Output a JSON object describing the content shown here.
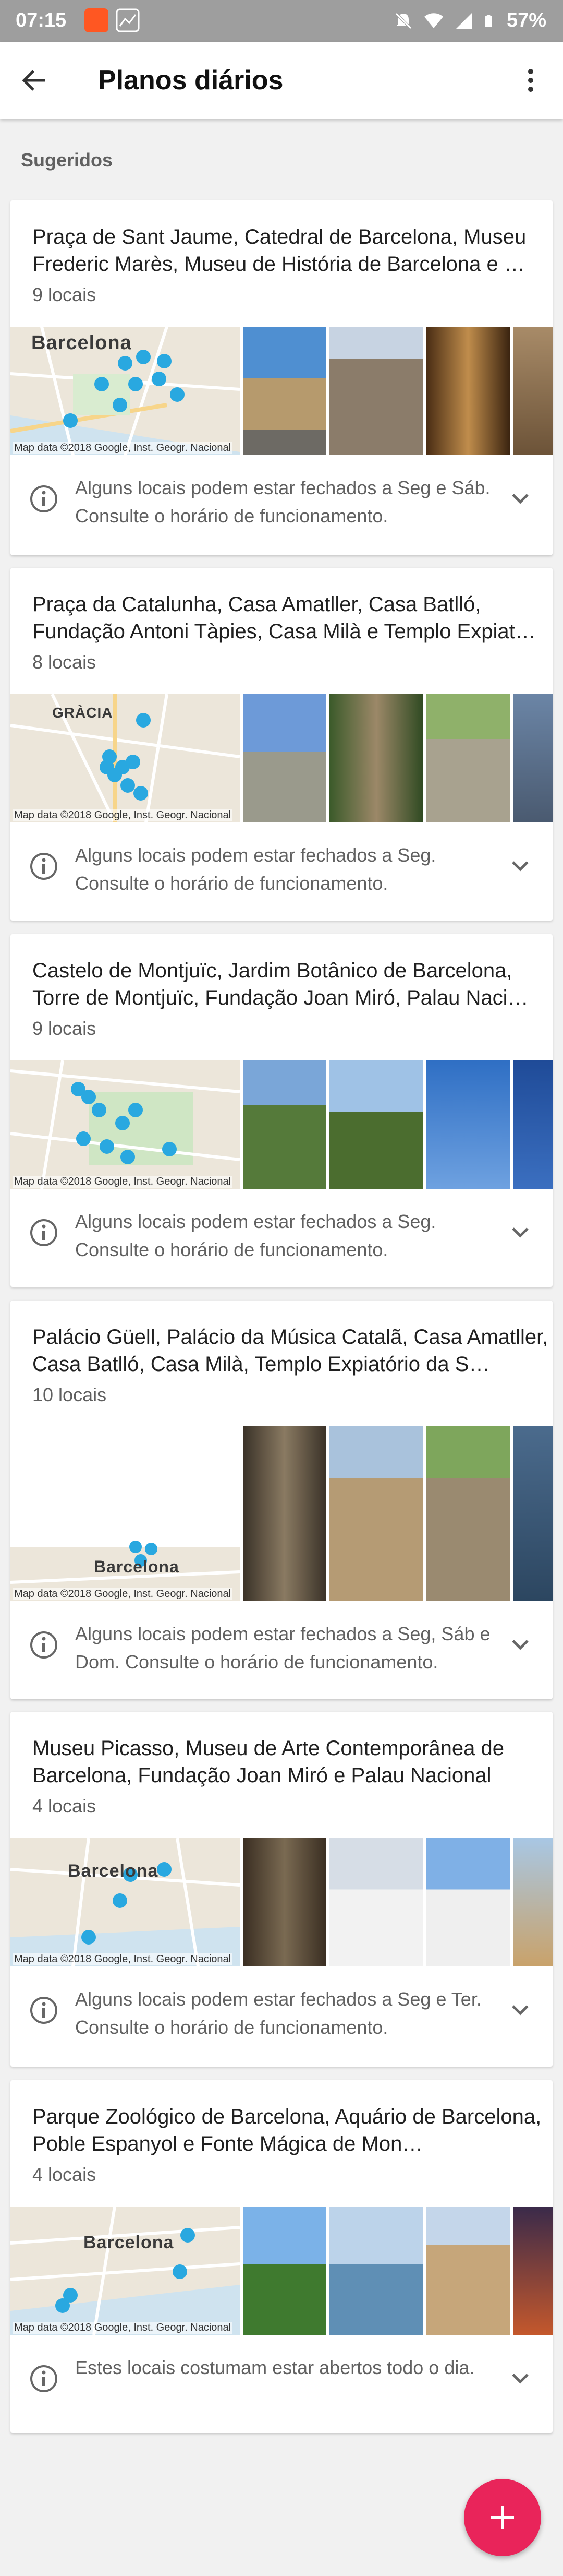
{
  "status_bar": {
    "time": "07:15",
    "battery": "57%"
  },
  "app_bar": {
    "title": "Planos diários"
  },
  "section": {
    "label": "Sugeridos"
  },
  "map_credit": "Map data ©2018 Google, Inst. Geogr. Nacional",
  "cards": [
    {
      "title": "Praça de Sant Jaume, Catedral de Barcelona, Museu Frederic Marès, Museu de História de Barcelona e …",
      "count": "9 locais",
      "map_label": "Barcelona",
      "note": "Alguns locais podem estar fechados a Seg e Sáb. Consulte o horário de funcionamento."
    },
    {
      "title": "Praça da Catalunha, Casa Amatller, Casa Batlló, Fundação Antoni Tàpies, Casa Milà e Templo Expiat…",
      "count": "8 locais",
      "map_label": "GRÀCIA",
      "note": "Alguns locais podem estar fechados a Seg. Consulte o horário de funcionamento."
    },
    {
      "title": "Castelo de Montjuïc, Jardim Botânico de Barcelona, Torre de Montjuïc, Fundação Joan Miró, Palau Naci…",
      "count": "9 locais",
      "map_label": "",
      "note": "Alguns locais podem estar fechados a Seg. Consulte o horário de funcionamento."
    },
    {
      "title": "Palácio Güell, Palácio da Música Catalã, Casa Amatller, Casa Batlló, Casa Milà, Templo Expiatório da S…",
      "count": "10 locais",
      "map_label": "Barcelona",
      "note": "Alguns locais podem estar fechados a Seg, Sáb e Dom. Consulte o horário de funcionamento."
    },
    {
      "title": "Museu Picasso, Museu de Arte Contemporânea de Barcelona, Fundação Joan Miró e Palau Nacional",
      "count": "4 locais",
      "map_label": "Barcelona",
      "note": "Alguns locais podem estar fechados a Seg e Ter. Consulte o horário de funcionamento."
    },
    {
      "title": "Parque Zoológico de Barcelona, Aquário de Barcelona, Poble Espanyol e Fonte Mágica de Mon…",
      "count": "4 locais",
      "map_label": "Barcelona",
      "note": "Estes locais costumam estar abertos todo o dia."
    }
  ],
  "icons": {
    "back": "arrow-back-icon",
    "more": "more-vert-icon",
    "info": "info-icon",
    "expand": "chevron-down-icon",
    "fab": "plus-icon"
  },
  "colors": {
    "accent": "#e9245a",
    "map_pin": "#29a8e0"
  }
}
